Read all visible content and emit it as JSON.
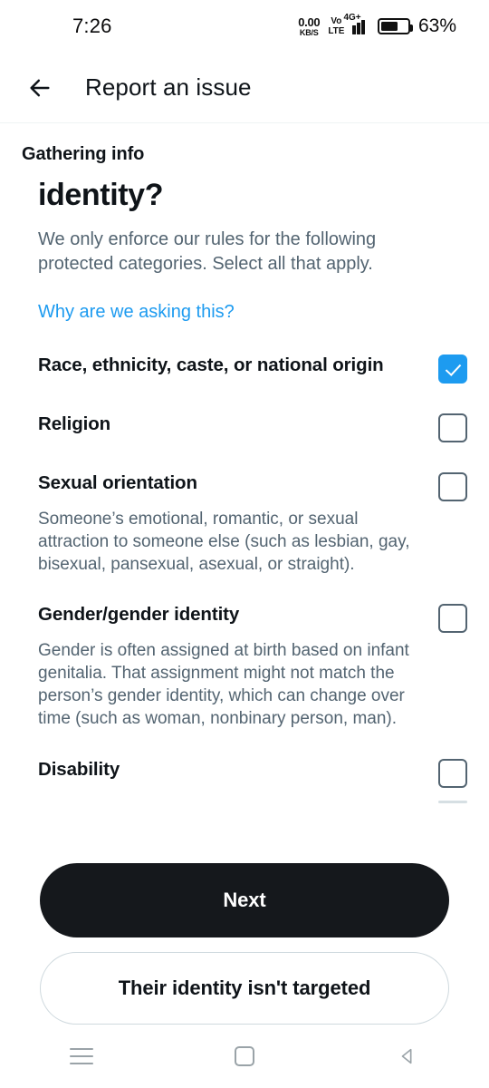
{
  "status_bar": {
    "time": "7:26",
    "net_speed_value": "0.00",
    "net_speed_unit": "KB/S",
    "volte_line1": "Vo",
    "volte_line2": "LTE",
    "network_type": "4G+",
    "battery_percent": "63%"
  },
  "app_bar": {
    "title": "Report an issue",
    "back_icon": "arrow-left-icon"
  },
  "main": {
    "kicker": "Gathering info",
    "headline": "identity?",
    "description": "We only enforce our rules for the following protected categories. Select all that apply.",
    "why_link": "Why are we asking this?"
  },
  "options": [
    {
      "label": "Race, ethnicity, caste, or national origin",
      "description": "",
      "checked": true
    },
    {
      "label": "Religion",
      "description": "",
      "checked": false
    },
    {
      "label": "Sexual orientation",
      "description": "Someone’s emotional, romantic, or sexual attraction to someone else (such as lesbian, gay, bisexual, pansexual, asexual, or straight).",
      "checked": false
    },
    {
      "label": "Gender/gender identity",
      "description": "Gender is often assigned at birth based on infant genitalia. That assignment might not match the person’s gender identity, which can change over time (such as woman, nonbinary person, man).",
      "checked": false
    },
    {
      "label": "Disability",
      "description": "",
      "checked": false
    }
  ],
  "actions": {
    "primary_label": "Next",
    "secondary_label": "Their identity isn't targeted"
  },
  "nav_bar": {
    "recents_icon": "recents-icon",
    "home_icon": "home-icon",
    "back_icon": "back-triangle-icon"
  },
  "colors": {
    "accent_blue": "#1D9BF0",
    "text_primary": "#0F1419",
    "text_secondary": "#536471",
    "button_black": "#15181C",
    "border": "#CFD9DE"
  }
}
